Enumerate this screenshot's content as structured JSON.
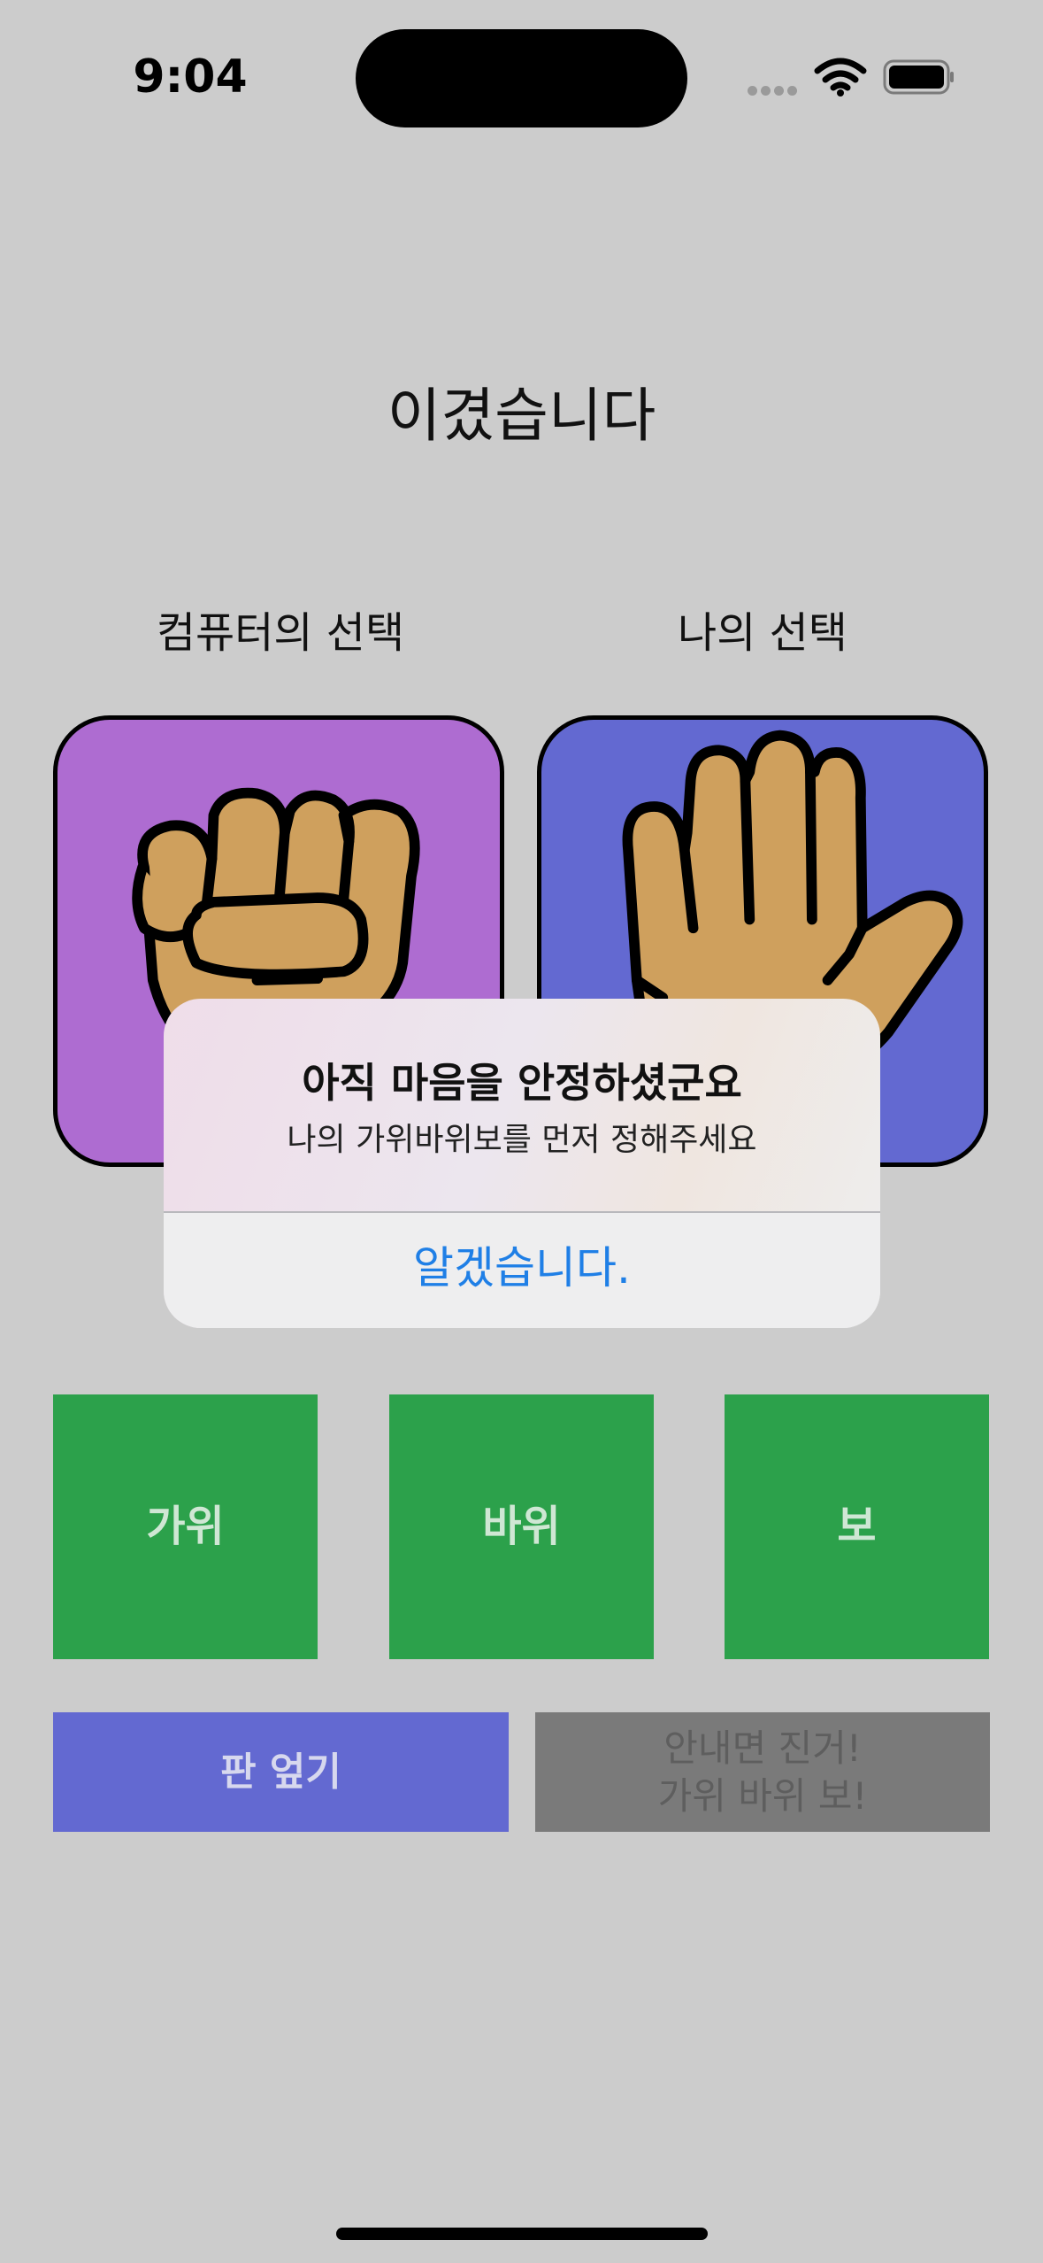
{
  "status_bar": {
    "time": "9:04"
  },
  "game": {
    "result": "이겼습니다",
    "computer_label": "컴퓨터의 선택",
    "my_label": "나의 선택"
  },
  "alert": {
    "title": "아직 마음을 안정하셨군요",
    "message": "나의 가위바위보를 먼저 정해주세요",
    "confirm": "알겠습니다."
  },
  "buttons": {
    "scissors": "가위",
    "rock": "바위",
    "paper": "보",
    "reset": "판 엎기",
    "play_line1": "안내면 진거!",
    "play_line2": "가위 바위 보!"
  },
  "colors": {
    "background": "#cccccc",
    "computer_card": "#ae6cd1",
    "my_card": "#6369d1",
    "choice_button": "#2ca14b",
    "reset_button": "#6369d1",
    "play_button_disabled": "#7a7a7a",
    "alert_action": "#1f7fe6"
  },
  "icons": {
    "computer_choice": "fist-icon",
    "my_choice": "open-palm-icon"
  }
}
